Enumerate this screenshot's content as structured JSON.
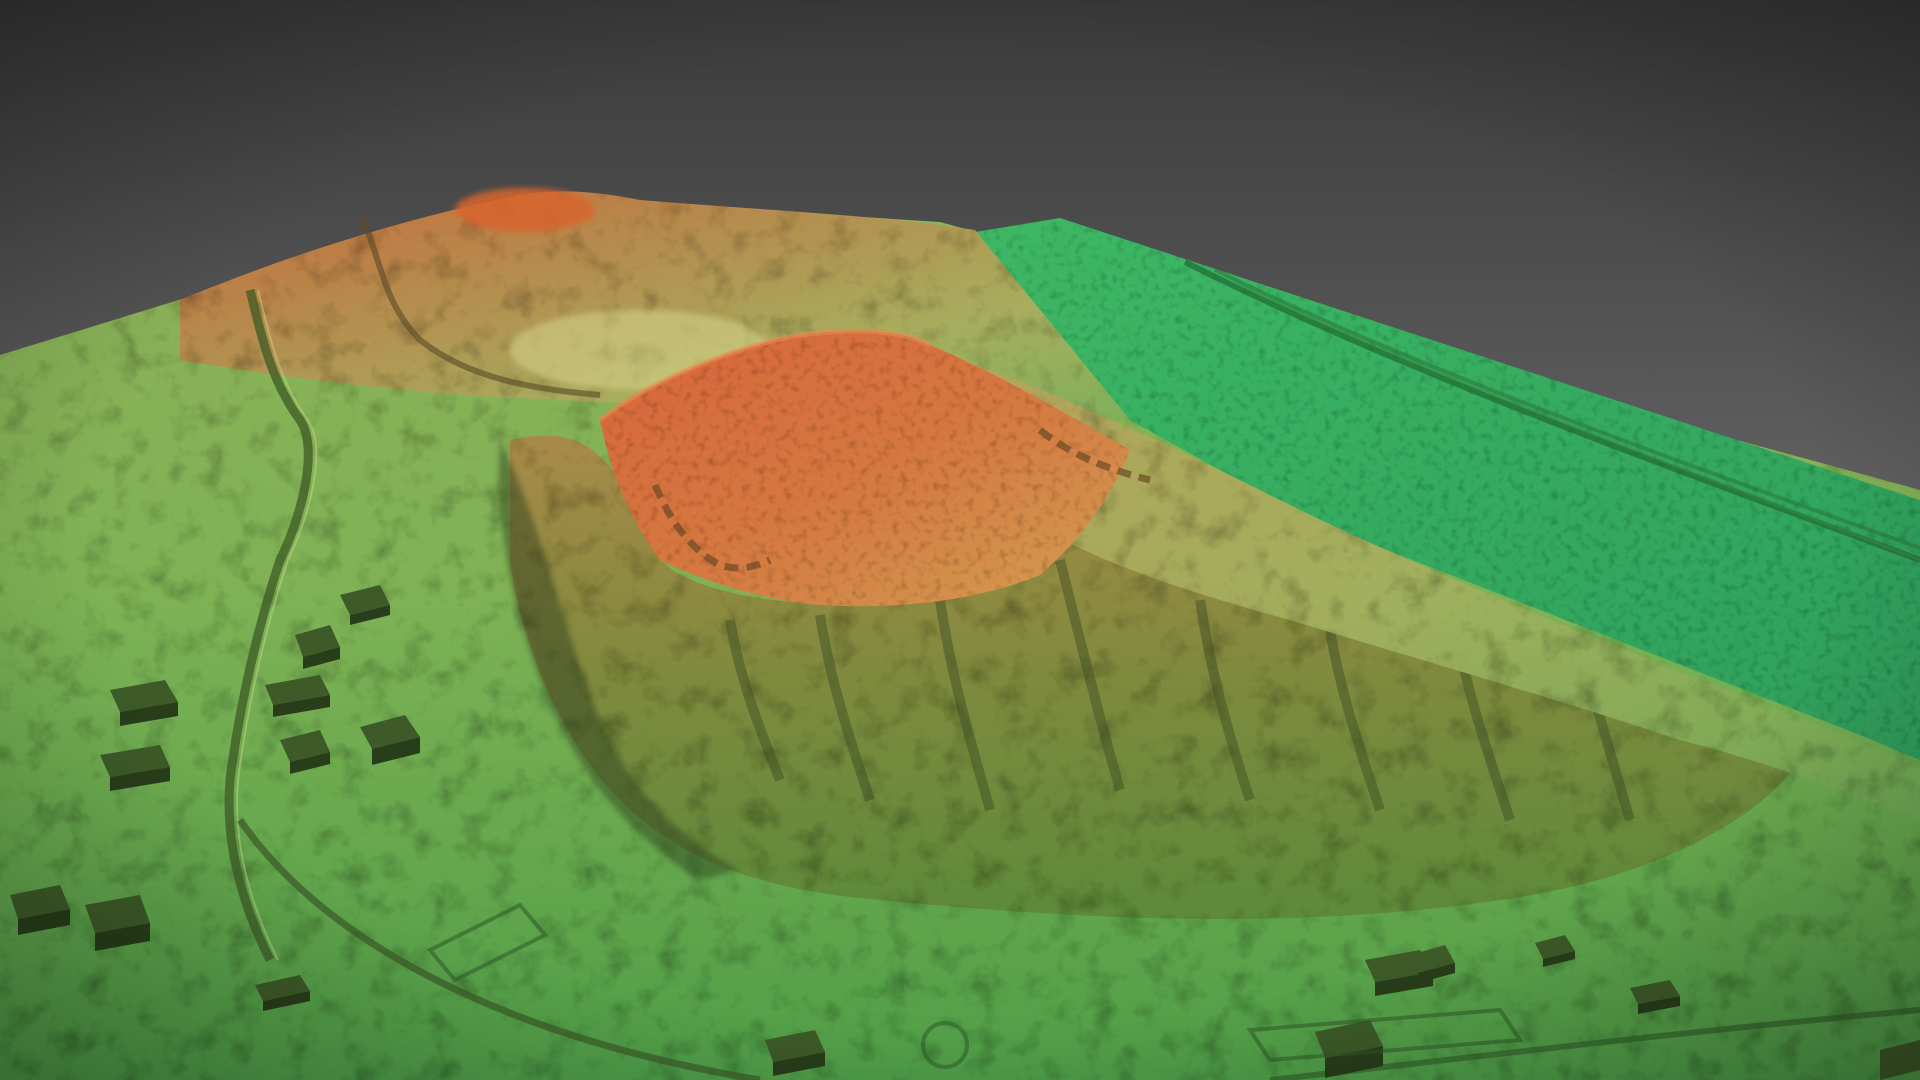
{
  "scene": {
    "subject": "lidar-terrain-relief",
    "palette": {
      "sky_top": "#3a3a3a",
      "sky_bottom": "#8a8a8a",
      "low_elevation": "#3fae5a",
      "mid_low": "#7fbf5a",
      "mid": "#c8c870",
      "mid_high": "#d9a060",
      "high_elevation": "#d2663a",
      "river_plain": "#33b062",
      "shadow": "#2c3a20"
    }
  }
}
